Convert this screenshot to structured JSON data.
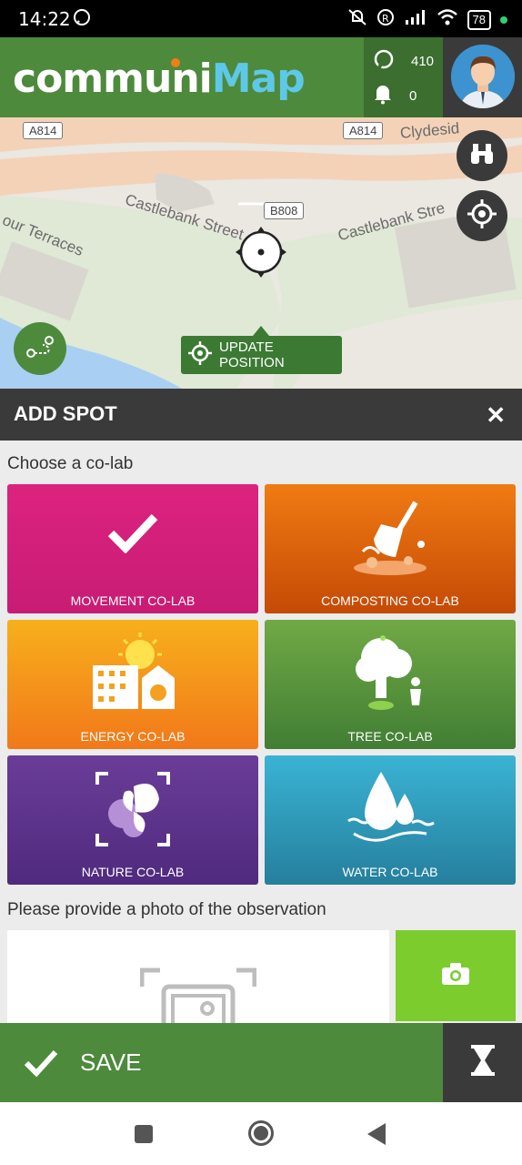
{
  "status_bar": {
    "time": "14:22",
    "battery": "78"
  },
  "header": {
    "logo_part1": "communi",
    "logo_part2": "Map",
    "points": "410",
    "notifications": "0"
  },
  "map": {
    "road_labels": [
      "A814",
      "A814",
      "B808"
    ],
    "streets": [
      "Castlebank Street",
      "Castlebank Stre",
      "Clydesid",
      "our Terraces"
    ],
    "update_position": "UPDATE POSITION"
  },
  "add_spot": {
    "title": "ADD SPOT",
    "choose_label": "Choose a co-lab",
    "tiles": [
      {
        "label": "MOVEMENT CO-LAB",
        "color": "#d62081"
      },
      {
        "label": "COMPOSTING CO-LAB",
        "color": "#e9630e"
      },
      {
        "label": "ENERGY CO-LAB",
        "color": "#f59c1e"
      },
      {
        "label": "TREE CO-LAB",
        "color": "#5b9a3d"
      },
      {
        "label": "NATURE CO-LAB",
        "color": "#5c3492"
      },
      {
        "label": "WATER CO-LAB",
        "color": "#2f9fc0"
      }
    ],
    "photo_label": "Please provide a photo of the observation"
  },
  "save": {
    "label": "SAVE"
  },
  "colors": {
    "brand_green": "#4d8a3c",
    "dark": "#3a3a3a",
    "camera_green": "#7ccc2e"
  }
}
